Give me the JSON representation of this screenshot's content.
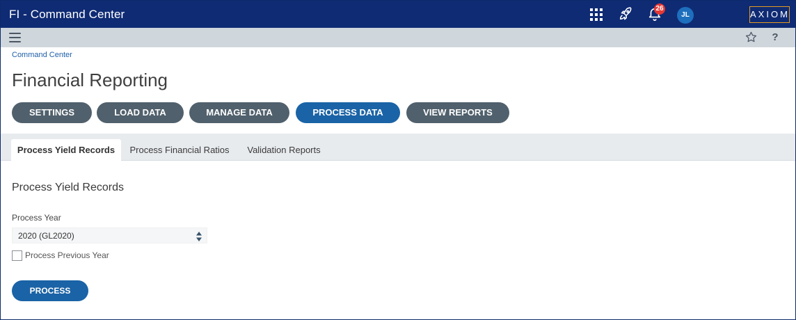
{
  "header": {
    "app_title": "FI - Command Center",
    "notification_count": "26",
    "user_initials": "JL",
    "logo_text": "AXIOM",
    "icons": [
      "apps-grid-icon",
      "rocket-icon",
      "bell-icon"
    ]
  },
  "subbar": {
    "icons": [
      "menu-icon",
      "star-icon",
      "help-icon"
    ],
    "help_glyph": "?"
  },
  "breadcrumb": "Command Center",
  "page_title": "Financial Reporting",
  "nav_buttons": [
    {
      "label": "SETTINGS",
      "active": false
    },
    {
      "label": "LOAD DATA",
      "active": false
    },
    {
      "label": "MANAGE DATA",
      "active": false
    },
    {
      "label": "PROCESS DATA",
      "active": true
    },
    {
      "label": "VIEW REPORTS",
      "active": false
    }
  ],
  "tabs": [
    {
      "label": "Process Yield Records",
      "active": true
    },
    {
      "label": "Process Financial Ratios",
      "active": false
    },
    {
      "label": "Validation Reports",
      "active": false
    }
  ],
  "form": {
    "section_title": "Process Yield Records",
    "process_year_label": "Process Year",
    "process_year_value": "2020 (GL2020)",
    "previous_year_label": "Process Previous Year",
    "previous_year_checked": false,
    "process_button_label": "PROCESS"
  },
  "colors": {
    "header_bg": "#0f2b74",
    "subbar_bg": "#cfd6dc",
    "nav_button": "#50606c",
    "primary": "#1a63a6",
    "badge": "#e53935",
    "logo_border": "#e59b1f"
  }
}
